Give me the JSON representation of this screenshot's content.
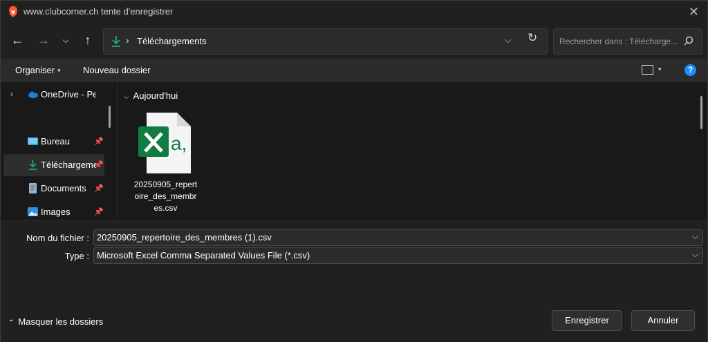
{
  "window": {
    "title": "www.clubcorner.ch tente d'enregistrer",
    "close_icon": "close-icon"
  },
  "nav": {
    "back": "back-icon",
    "forward": "forward-icon",
    "history": "chevron-down-icon",
    "up": "up-icon"
  },
  "address": {
    "location_icon": "download-icon",
    "separator": "›",
    "path": "Téléchargements",
    "dropdown": "⌵",
    "refresh": "↻"
  },
  "search": {
    "placeholder": "Rechercher dans : Télécharge...",
    "icon": "search-icon"
  },
  "toolbar": {
    "organize": "Organiser",
    "new_folder": "Nouveau dossier",
    "view_icon": "view-icon",
    "help": "?"
  },
  "sidebar": {
    "items": [
      {
        "label": "OneDrive - Perso",
        "icon": "onedrive-icon",
        "pinned": false
      },
      {
        "label": "Bureau",
        "icon": "desktop-icon",
        "pinned": true
      },
      {
        "label": "Téléchargements",
        "icon": "download-icon",
        "pinned": true,
        "selected": true
      },
      {
        "label": "Documents",
        "icon": "documents-icon",
        "pinned": true
      },
      {
        "label": "Images",
        "icon": "images-icon",
        "pinned": true
      }
    ]
  },
  "files": {
    "group_label": "Aujourd'hui",
    "items": [
      {
        "name": "20250905_repertoire_des_membres.csv",
        "icon": "excel-csv-icon"
      }
    ]
  },
  "form": {
    "filename_label": "Nom du fichier :",
    "filename_value": "20250905_repertoire_des_membres (1).csv",
    "type_label": "Type :",
    "type_value": "Microsoft Excel Comma Separated Values File (*.csv)"
  },
  "footer": {
    "hide_folders": "Masquer les dossiers",
    "save": "Enregistrer",
    "cancel": "Annuler"
  },
  "colors": {
    "accent": "#1a8dff",
    "excel_green": "#107c41",
    "download_green": "#2aa876",
    "background": "#202020"
  }
}
